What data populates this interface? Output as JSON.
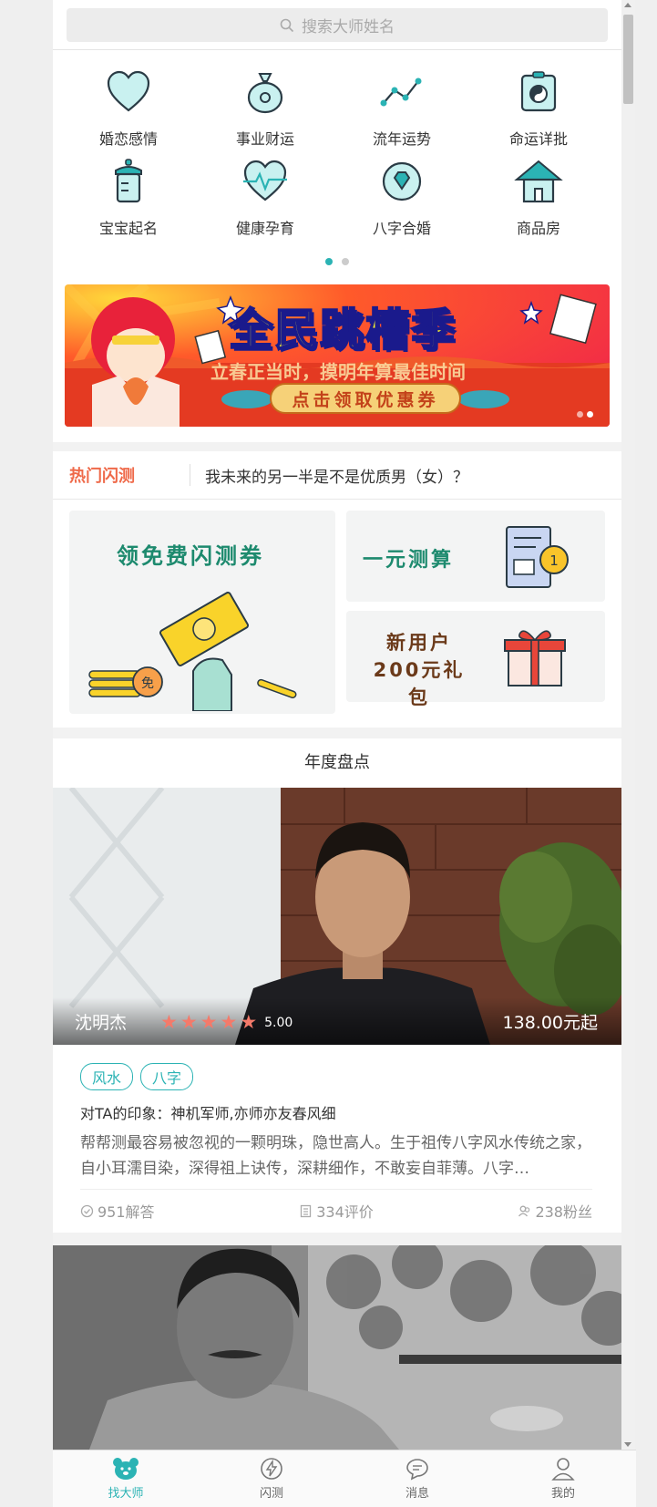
{
  "search": {
    "placeholder": "搜索大师姓名"
  },
  "categories": [
    {
      "label": "婚恋感情",
      "icon": "heart-icon"
    },
    {
      "label": "事业财运",
      "icon": "money-bag-icon"
    },
    {
      "label": "流年运势",
      "icon": "trend-line-icon"
    },
    {
      "label": "命运详批",
      "icon": "yin-yang-icon"
    },
    {
      "label": "宝宝起名",
      "icon": "baby-bottle-icon"
    },
    {
      "label": "健康孕育",
      "icon": "heartbeat-icon"
    },
    {
      "label": "八字合婚",
      "icon": "diamond-ring-icon"
    },
    {
      "label": "商品房",
      "icon": "house-icon"
    }
  ],
  "banner": {
    "title": "全民跳槽季",
    "subtitle": "立春正当时，摸明年算最佳时间",
    "coupon": "点击领取优惠券"
  },
  "hot": {
    "title": "热门闪测",
    "question": "我未来的另一半是不是优质男（女）？",
    "card_free": "领免费闪测券",
    "card_one_yuan": "一元测算",
    "card_new_user_line1": "新用户",
    "card_new_user_line2": "200元礼包"
  },
  "annual": {
    "title": "年度盘点",
    "master": {
      "name": "沈明杰",
      "score": "5.00",
      "rating": 5,
      "price": "138.00元起",
      "tags": [
        "风水",
        "八字"
      ],
      "impression": "对TA的印象：神机军师,亦师亦友春风细",
      "description": "帮帮测最容易被忽视的一颗明珠，隐世高人。生于祖传八字风水传统之家，自小耳濡目染，深得祖上诀传，深耕细作，不敢妄自菲薄。八字…",
      "answers": "951解答",
      "reviews": "334评价",
      "fans": "238粉丝"
    }
  },
  "tabbar": [
    {
      "label": "找大师",
      "icon": "bear-icon",
      "active": true
    },
    {
      "label": "闪测",
      "icon": "lightning-icon",
      "active": false
    },
    {
      "label": "消息",
      "icon": "chat-icon",
      "active": false
    },
    {
      "label": "我的",
      "icon": "user-icon",
      "active": false
    }
  ],
  "colors": {
    "accent": "#2bb3b4",
    "hot": "#ef6a4a",
    "star": "#f47a6a"
  }
}
